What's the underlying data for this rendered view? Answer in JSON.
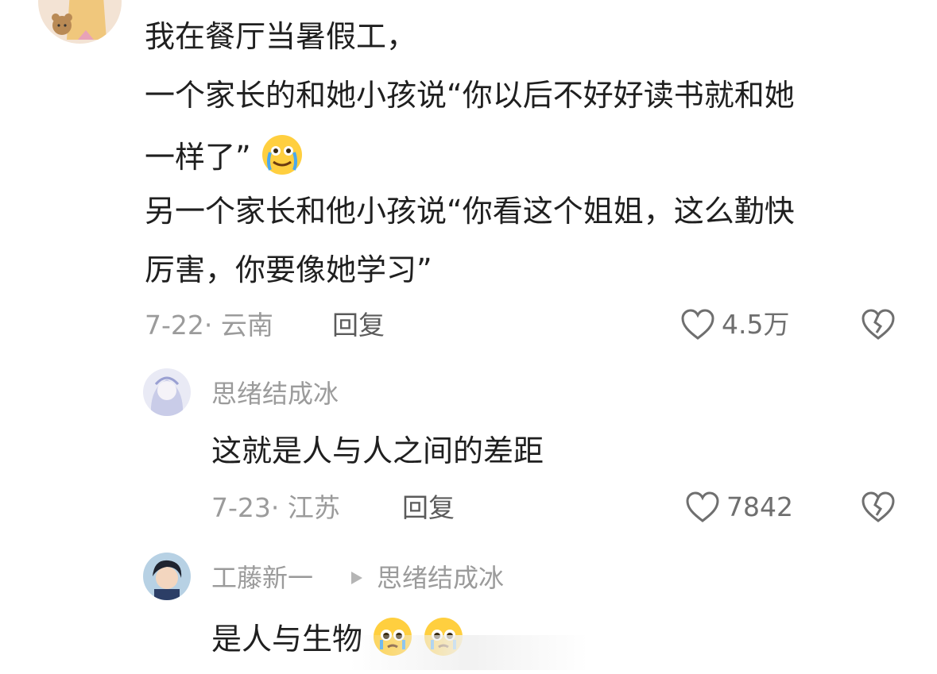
{
  "comments": {
    "main": {
      "lines": [
        "我在餐厅当暑假工，",
        "一个家长的和她小孩说“你以后不好好读书就和她",
        "一样了”",
        "另一个家长和他小孩说“你看这个姐姐，这么勤快",
        "厉害，你要像她学习”"
      ],
      "date_location": "7-22· 云南",
      "reply_label": "回复",
      "like_count": "4.5万"
    },
    "reply1": {
      "username": "思绪结成冰",
      "text": "这就是人与人之间的差距",
      "date_location": "7-23· 江苏",
      "reply_label": "回复",
      "like_count": "7842"
    },
    "reply2": {
      "username": "工藤新一",
      "reply_to": "思绪结成冰",
      "text": "是人与生物"
    }
  },
  "colors": {
    "text": "#1f1f1f",
    "meta": "#9b9b9b",
    "reply_label": "#5b5b5b",
    "icon": "#6f6f6f"
  }
}
